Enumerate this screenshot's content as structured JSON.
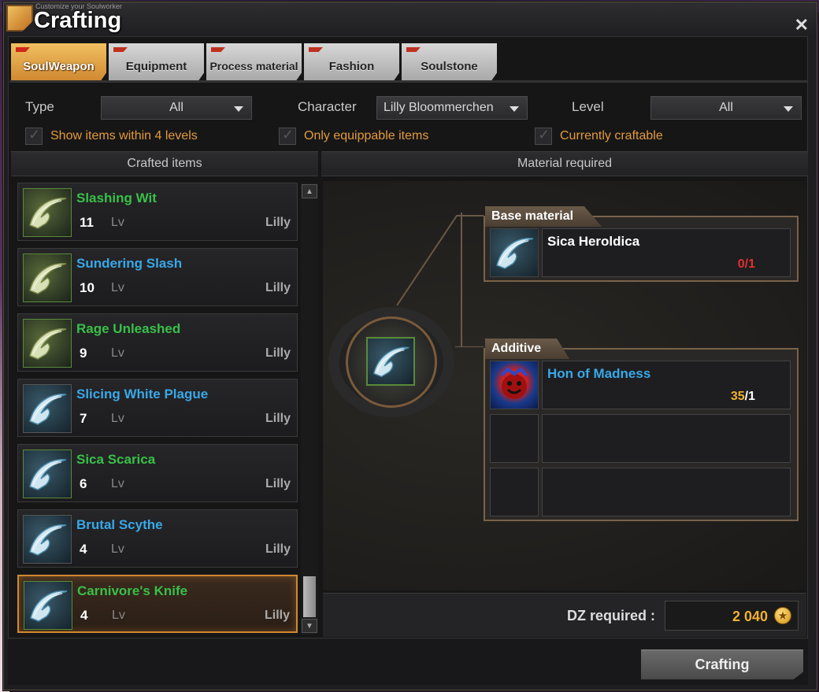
{
  "window": {
    "subtitle": "Customize your Soulworker",
    "title": "Crafting",
    "close": "✕"
  },
  "tabs": [
    {
      "label": "SoulWeapon",
      "active": true
    },
    {
      "label": "Equipment",
      "active": false
    },
    {
      "label": "Process material",
      "active": false
    },
    {
      "label": "Fashion",
      "active": false
    },
    {
      "label": "Soulstone",
      "active": false
    }
  ],
  "filters": {
    "type_label": "Type",
    "type_value": "All",
    "character_label": "Character",
    "character_value": "Lilly Bloommerchen",
    "level_label": "Level",
    "level_value": "All"
  },
  "checks": {
    "within_levels": "Show items within 4 levels",
    "equippable": "Only equippable items",
    "craftable": "Currently craftable"
  },
  "headers": {
    "crafted": "Crafted items",
    "material": "Material required"
  },
  "items": [
    {
      "name": "Slashing Wit",
      "level": "11",
      "lv": "Lv",
      "owner": "Lilly",
      "color": "green"
    },
    {
      "name": "Sundering Slash",
      "level": "10",
      "lv": "Lv",
      "owner": "Lilly",
      "color": "blue"
    },
    {
      "name": "Rage Unleashed",
      "level": "9",
      "lv": "Lv",
      "owner": "Lilly",
      "color": "green"
    },
    {
      "name": "Slicing White Plague",
      "level": "7",
      "lv": "Lv",
      "owner": "Lilly",
      "color": "blue"
    },
    {
      "name": "Sica Scarica",
      "level": "6",
      "lv": "Lv",
      "owner": "Lilly",
      "color": "green"
    },
    {
      "name": "Brutal Scythe",
      "level": "4",
      "lv": "Lv",
      "owner": "Lilly",
      "color": "blue"
    },
    {
      "name": "Carnivore's Knife",
      "level": "4",
      "lv": "Lv",
      "owner": "Lilly",
      "color": "green"
    }
  ],
  "base_material": {
    "title": "Base material",
    "name": "Sica Heroldica",
    "have": "0",
    "need": "/1"
  },
  "additive": {
    "title": "Additive",
    "name": "Hon of Madness",
    "have": "35",
    "need": "/1"
  },
  "dz": {
    "label": "DZ required :",
    "value": "2 040"
  },
  "craft_button": "Crafting",
  "colors": {
    "accent": "#d08830",
    "green": "#38c048",
    "blue": "#38a8e8",
    "gold": "#f0b030",
    "red": "#e03030"
  }
}
